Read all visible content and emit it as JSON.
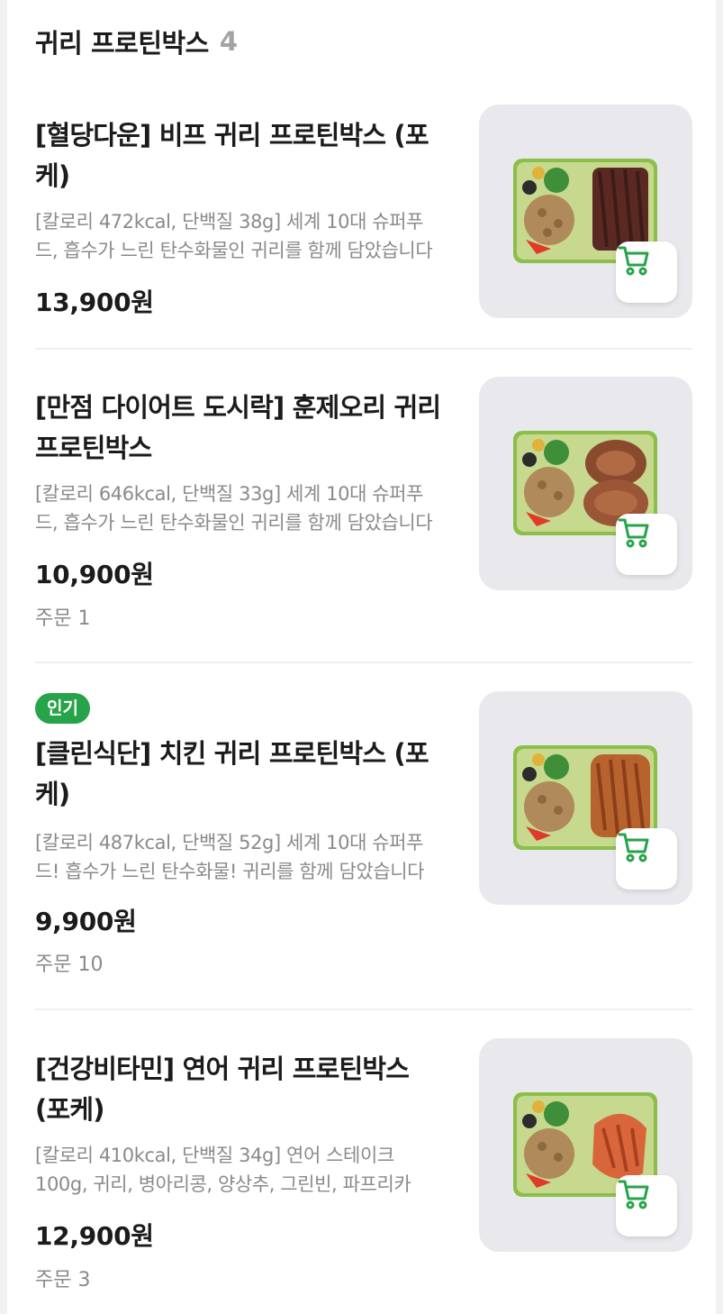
{
  "section": {
    "title": "귀리 프로틴박스",
    "count": "4"
  },
  "products": [
    {
      "badge": "",
      "title": "[혈당다운] 비프 귀리 프로틴박스 (포케)",
      "description": "[칼로리 472kcal, 단백질 38g] 세계 10대 슈퍼푸드, 흡수가 느린 탄수화물인 귀리를 함께 담았습니다",
      "price": "13,900원",
      "orders": "",
      "protein": "beef"
    },
    {
      "badge": "",
      "title": "[만점 다이어트 도시락] 훈제오리 귀리 프로틴박스",
      "description": "[칼로리 646kcal, 단백질 33g] 세계 10대 슈퍼푸드, 흡수가 느린 탄수화물인 귀리를 함께 담았습니다",
      "price": "10,900원",
      "orders": "주문 1",
      "protein": "duck"
    },
    {
      "badge": "인기",
      "title": "[클린식단] 치킨 귀리 프로틴박스 (포케)",
      "description": "[칼로리 487kcal, 단백질 52g] 세계 10대 슈퍼푸드! 흡수가 느린 탄수화물! 귀리를 함께 담았습니다",
      "price": "9,900원",
      "orders": "주문 10",
      "protein": "chicken"
    },
    {
      "badge": "",
      "title": "[건강비타민] 연어 귀리 프로틴박스 (포케)",
      "description": "[칼로리 410kcal, 단백질 34g] 연어 스테이크 100g, 귀리, 병아리콩, 양상추, 그린빈, 파프리카",
      "price": "12,900원",
      "orders": "주문 3",
      "protein": "salmon"
    }
  ],
  "icons": {
    "cart": "cart-icon"
  },
  "colors": {
    "accent": "#27a34a",
    "muted": "#8a8a8a"
  }
}
